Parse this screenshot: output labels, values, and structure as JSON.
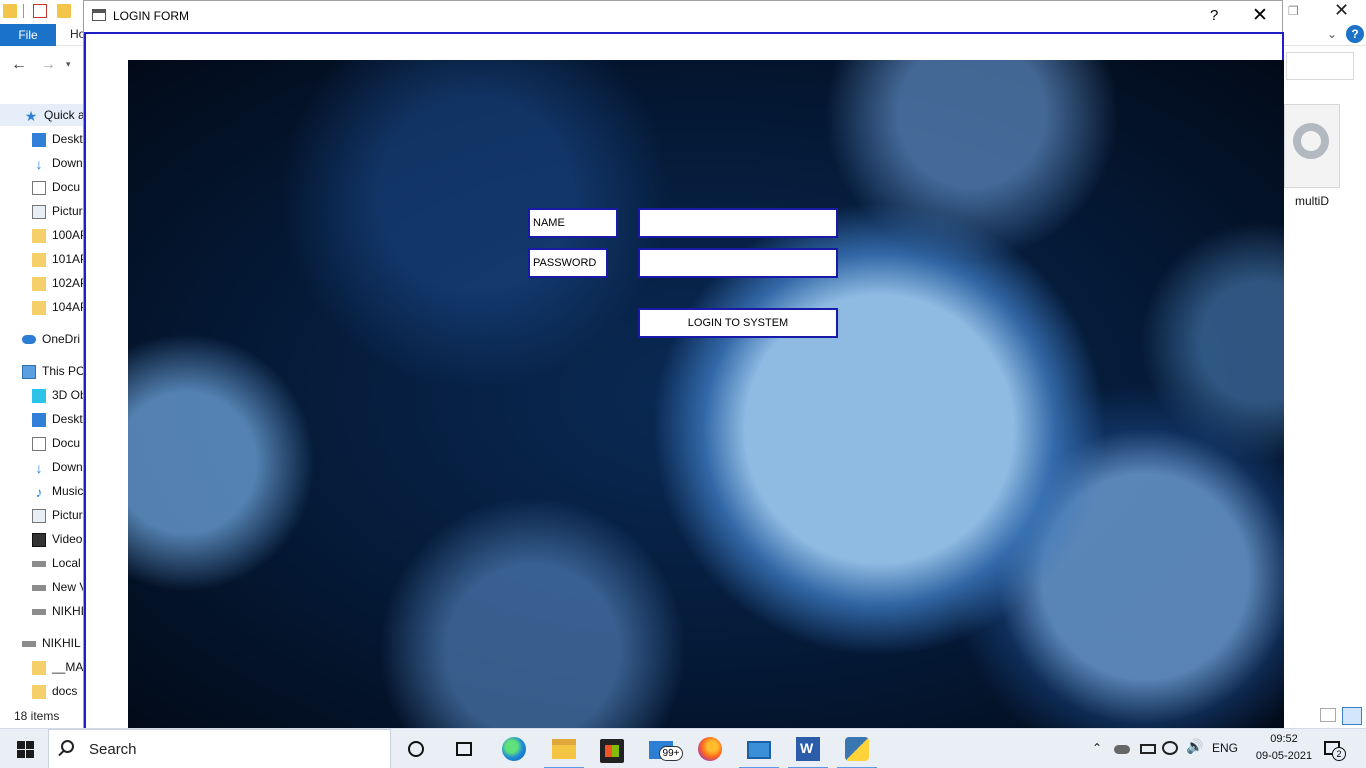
{
  "explorer": {
    "ribbon_tabs": [
      "File",
      "Ho"
    ],
    "sidebar": [
      {
        "label": "Quick a",
        "icon": "star-icon",
        "selected": true
      },
      {
        "label": "Deskt",
        "icon": "desktop-icon"
      },
      {
        "label": "Down",
        "icon": "download-icon"
      },
      {
        "label": "Docu",
        "icon": "document-icon"
      },
      {
        "label": "Pictur",
        "icon": "pictures-icon"
      },
      {
        "label": "100AP",
        "icon": "folder-icon"
      },
      {
        "label": "101AP",
        "icon": "folder-icon"
      },
      {
        "label": "102AP",
        "icon": "folder-icon"
      },
      {
        "label": "104AP",
        "icon": "folder-icon"
      },
      {
        "label": "OneDri",
        "icon": "onedrive-icon"
      },
      {
        "label": "This PC",
        "icon": "pc-icon"
      },
      {
        "label": "3D Ob",
        "icon": "cube-icon"
      },
      {
        "label": "Deskt",
        "icon": "desktop-icon"
      },
      {
        "label": "Docu",
        "icon": "document-icon"
      },
      {
        "label": "Down",
        "icon": "download-icon"
      },
      {
        "label": "Music",
        "icon": "music-icon"
      },
      {
        "label": "Pictur",
        "icon": "pictures-icon"
      },
      {
        "label": "Video",
        "icon": "video-icon"
      },
      {
        "label": "Local",
        "icon": "drive-icon"
      },
      {
        "label": "New V",
        "icon": "drive-icon"
      },
      {
        "label": "NIKHI",
        "icon": "drive-icon"
      },
      {
        "label": "NIKHIL",
        "icon": "drive-icon"
      },
      {
        "label": "__MA",
        "icon": "folder-icon"
      },
      {
        "label": "docs",
        "icon": "folder-icon"
      }
    ],
    "status": "18 items",
    "file_label": "multiD"
  },
  "login": {
    "title": "LOGIN FORM",
    "help_label": "?",
    "close_label": "✕",
    "name_label": "NAME",
    "password_label": "PASSWORD",
    "name_value": "",
    "password_value": "",
    "button_label": "LOGIN TO SYSTEM"
  },
  "taskbar": {
    "search_placeholder": "Search",
    "mail_badge": "99+",
    "language": "ENG",
    "time": "09:52",
    "date": "09-05-2021",
    "notification_count": "2"
  },
  "colors": {
    "form_border": "#1a1aa8",
    "file_tab": "#1a73c8",
    "taskbar": "#eaeff6"
  }
}
